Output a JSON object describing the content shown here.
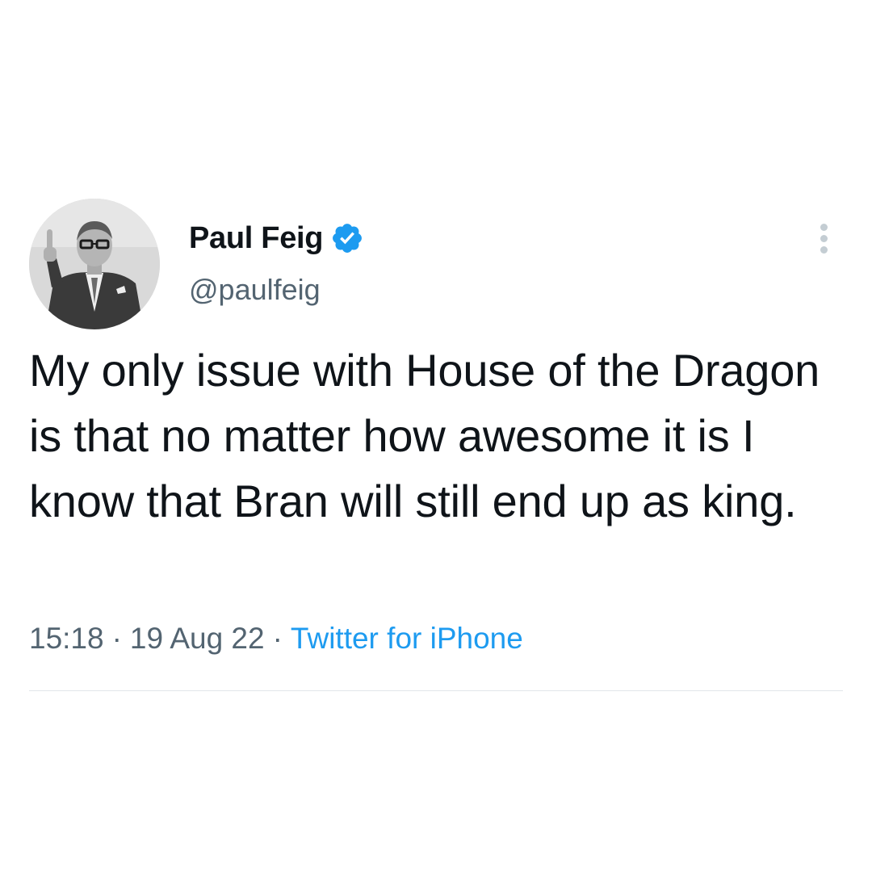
{
  "tweet": {
    "author": {
      "display_name": "Paul Feig",
      "handle": "@paulfeig",
      "verified": true,
      "avatar_icon": "profile-photo-avatar"
    },
    "text": "My only issue with House of the Dragon is that no matter how awesome it is I know that Bran will still end up as king.",
    "meta": {
      "time": "15:18",
      "date": "19 Aug 22",
      "separator": "·",
      "source": "Twitter for iPhone"
    },
    "more_icon": "more-options-icon"
  },
  "colors": {
    "text_primary": "#0f1419",
    "text_secondary": "#536471",
    "accent": "#1d9bf0",
    "divider": "#e1e6ea"
  }
}
